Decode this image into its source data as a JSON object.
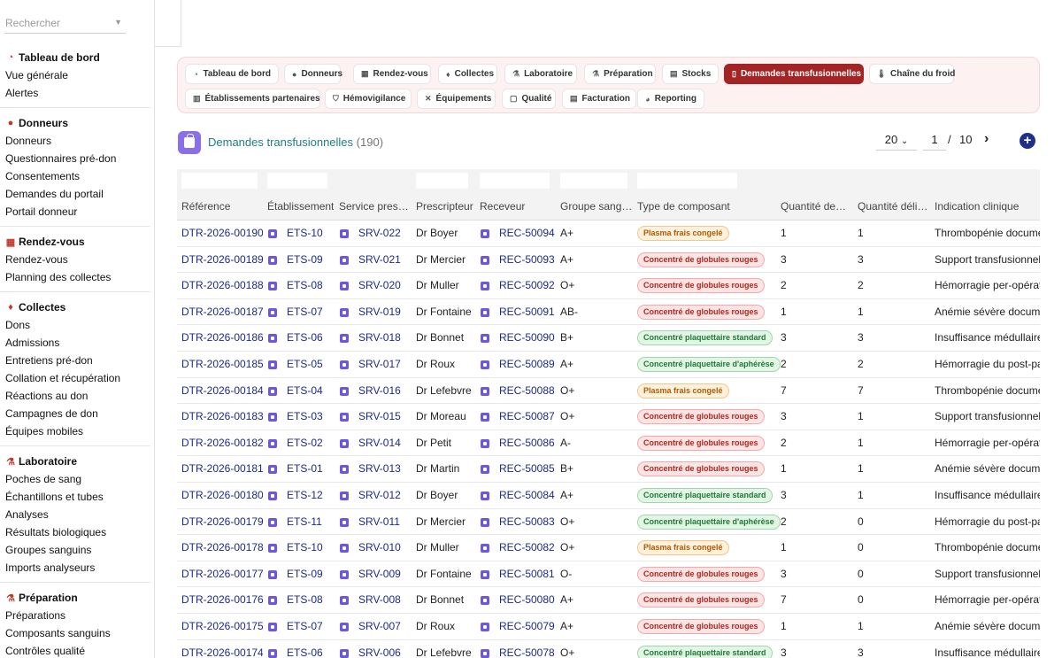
{
  "sidebar": {
    "search_placeholder": "Rechercher",
    "groups": [
      {
        "title": "Tableau de bord",
        "icon": "gauge-icon",
        "items": [
          "Vue générale",
          "Alertes"
        ]
      },
      {
        "title": "Donneurs",
        "icon": "user-icon",
        "items": [
          "Donneurs",
          "Questionnaires pré-don",
          "Consentements",
          "Demandes du portail",
          "Portail donneur"
        ]
      },
      {
        "title": "Rendez-vous",
        "icon": "calendar-icon",
        "items": [
          "Rendez-vous",
          "Planning des collectes"
        ]
      },
      {
        "title": "Collectes",
        "icon": "blood-drop-icon",
        "items": [
          "Dons",
          "Admissions",
          "Entretiens pré-don",
          "Collation et récupération",
          "Réactions au don",
          "Campagnes de don",
          "Équipes mobiles"
        ]
      },
      {
        "title": "Laboratoire",
        "icon": "microscope-icon",
        "items": [
          "Poches de sang",
          "Échantillons et tubes",
          "Analyses",
          "Résultats biologiques",
          "Groupes sanguins",
          "Imports analyseurs"
        ]
      },
      {
        "title": "Préparation",
        "icon": "flask-icon",
        "items": [
          "Préparations",
          "Composants sanguins",
          "Contrôles qualité"
        ]
      }
    ]
  },
  "tabs": [
    {
      "label": "Tableau de bord",
      "icon": "gauge-icon",
      "active": false
    },
    {
      "label": "Donneurs",
      "icon": "user-icon",
      "active": false
    },
    {
      "label": "Rendez-vous",
      "icon": "calendar-icon",
      "active": false
    },
    {
      "label": "Collectes",
      "icon": "blood-drop-icon",
      "active": false
    },
    {
      "label": "Laboratoire",
      "icon": "microscope-icon",
      "active": false
    },
    {
      "label": "Préparation",
      "icon": "flask-icon",
      "active": false
    },
    {
      "label": "Stocks",
      "icon": "warehouse-icon",
      "active": false
    },
    {
      "label": "Demandes transfusionnelles",
      "icon": "document-icon",
      "active": true
    },
    {
      "label": "Chaîne du froid",
      "icon": "thermometer-icon",
      "active": false
    },
    {
      "label": "Établissements partenaires",
      "icon": "building-icon",
      "active": false
    },
    {
      "label": "Hémovigilance",
      "icon": "shield-icon",
      "active": false
    },
    {
      "label": "Équipements",
      "icon": "tools-icon",
      "active": false
    },
    {
      "label": "Qualité",
      "icon": "clipboard-icon",
      "active": false
    },
    {
      "label": "Facturation",
      "icon": "invoice-icon",
      "active": false
    },
    {
      "label": "Reporting",
      "icon": "pie-chart-icon",
      "active": false
    }
  ],
  "page": {
    "title": "Demandes transfusionnelles",
    "count": "(190)",
    "page_size": "20",
    "current_page": "1",
    "separator": "/",
    "total_pages": "10"
  },
  "table": {
    "columns": [
      "Référence",
      "Établissement",
      "Service pres…",
      "Prescripteur",
      "Receveur",
      "Groupe sang…",
      "Type de composant",
      "Quantité de…",
      "Quantité déli…",
      "Indication clinique"
    ],
    "badge_colors": {
      "Plasma frais congelé": {
        "bg": "#fff1dc",
        "border": "#f5c58a",
        "text": "#b35a00"
      },
      "Concentré de globules rouges": {
        "bg": "#fde4e4",
        "border": "#f3a9a9",
        "text": "#b3261e"
      },
      "Concentré plaquettaire standard": {
        "bg": "#e3f6e6",
        "border": "#9fd8a8",
        "text": "#1e7a35"
      },
      "Concentré plaquettaire d'aphérèse": {
        "bg": "#e3f6e6",
        "border": "#9fd8a8",
        "text": "#1e7a35"
      }
    },
    "rows": [
      [
        "DTR-2026-00190",
        "ETS-10",
        "SRV-022",
        "Dr Boyer",
        "REC-50094",
        "A+",
        "Plasma frais congelé",
        "1",
        "1",
        "Thrombopénie documentée"
      ],
      [
        "DTR-2026-00189",
        "ETS-09",
        "SRV-021",
        "Dr Mercier",
        "REC-50093",
        "A+",
        "Concentré de globules rouges",
        "3",
        "3",
        "Support transfusionnel en"
      ],
      [
        "DTR-2026-00188",
        "ETS-08",
        "SRV-020",
        "Dr Muller",
        "REC-50092",
        "O+",
        "Concentré de globules rouges",
        "2",
        "2",
        "Hémorragie per-opératoire"
      ],
      [
        "DTR-2026-00187",
        "ETS-07",
        "SRV-019",
        "Dr Fontaine",
        "REC-50091",
        "AB-",
        "Concentré de globules rouges",
        "1",
        "1",
        "Anémie sévère documentée"
      ],
      [
        "DTR-2026-00186",
        "ETS-06",
        "SRV-018",
        "Dr Bonnet",
        "REC-50090",
        "B+",
        "Concentré plaquettaire standard",
        "3",
        "3",
        "Insuffisance médullaire"
      ],
      [
        "DTR-2026-00185",
        "ETS-05",
        "SRV-017",
        "Dr Roux",
        "REC-50089",
        "A+",
        "Concentré plaquettaire d'aphérèse",
        "2",
        "2",
        "Hémorragie du post-partum"
      ],
      [
        "DTR-2026-00184",
        "ETS-04",
        "SRV-016",
        "Dr Lefebvre",
        "REC-50088",
        "O+",
        "Plasma frais congelé",
        "7",
        "7",
        "Thrombopénie documentée"
      ],
      [
        "DTR-2026-00183",
        "ETS-03",
        "SRV-015",
        "Dr Moreau",
        "REC-50087",
        "O+",
        "Concentré de globules rouges",
        "3",
        "1",
        "Support transfusionnel en"
      ],
      [
        "DTR-2026-00182",
        "ETS-02",
        "SRV-014",
        "Dr Petit",
        "REC-50086",
        "A-",
        "Concentré de globules rouges",
        "2",
        "1",
        "Hémorragie per-opératoire"
      ],
      [
        "DTR-2026-00181",
        "ETS-01",
        "SRV-013",
        "Dr Martin",
        "REC-50085",
        "B+",
        "Concentré de globules rouges",
        "1",
        "1",
        "Anémie sévère documentée"
      ],
      [
        "DTR-2026-00180",
        "ETS-12",
        "SRV-012",
        "Dr Boyer",
        "REC-50084",
        "A+",
        "Concentré plaquettaire standard",
        "3",
        "1",
        "Insuffisance médullaire"
      ],
      [
        "DTR-2026-00179",
        "ETS-11",
        "SRV-011",
        "Dr Mercier",
        "REC-50083",
        "O+",
        "Concentré plaquettaire d'aphérèse",
        "2",
        "0",
        "Hémorragie du post-partum"
      ],
      [
        "DTR-2026-00178",
        "ETS-10",
        "SRV-010",
        "Dr Muller",
        "REC-50082",
        "O+",
        "Plasma frais congelé",
        "1",
        "0",
        "Thrombopénie documentée"
      ],
      [
        "DTR-2026-00177",
        "ETS-09",
        "SRV-009",
        "Dr Fontaine",
        "REC-50081",
        "O-",
        "Concentré de globules rouges",
        "3",
        "0",
        "Support transfusionnel en"
      ],
      [
        "DTR-2026-00176",
        "ETS-08",
        "SRV-008",
        "Dr Bonnet",
        "REC-50080",
        "A+",
        "Concentré de globules rouges",
        "7",
        "0",
        "Hémorragie per-opératoire"
      ],
      [
        "DTR-2026-00175",
        "ETS-07",
        "SRV-007",
        "Dr Roux",
        "REC-50079",
        "A+",
        "Concentré de globules rouges",
        "1",
        "1",
        "Anémie sévère documentée"
      ],
      [
        "DTR-2026-00174",
        "ETS-06",
        "SRV-006",
        "Dr Lefebvre",
        "REC-50078",
        "O+",
        "Concentré plaquettaire standard",
        "3",
        "3",
        "Insuffisance médullaire"
      ]
    ]
  }
}
